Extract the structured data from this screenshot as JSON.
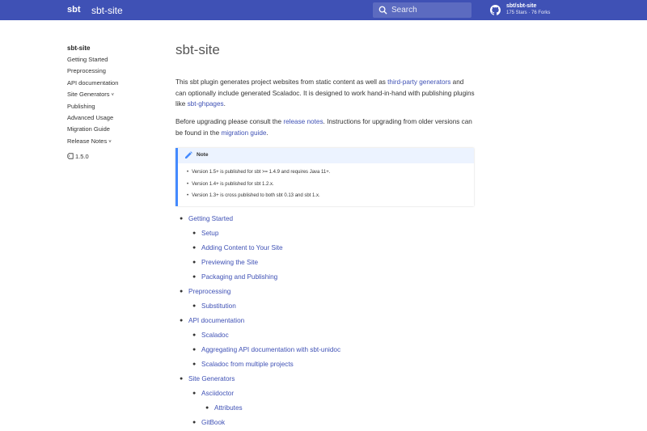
{
  "header": {
    "logo": "sbt",
    "title": "sbt-site",
    "search_placeholder": "Search",
    "repo_name": "sbt/sbt-site",
    "repo_stats": "175 Stars · 76 Forks"
  },
  "sidebar": {
    "title": "sbt-site",
    "items": [
      {
        "label": "Getting Started",
        "chevron": ""
      },
      {
        "label": "Preprocessing",
        "chevron": ""
      },
      {
        "label": "API documentation",
        "chevron": ""
      },
      {
        "label": "Site Generators",
        "chevron": "˅"
      },
      {
        "label": "Publishing",
        "chevron": ""
      },
      {
        "label": "Advanced Usage",
        "chevron": ""
      },
      {
        "label": "Migration Guide",
        "chevron": ""
      },
      {
        "label": "Release Notes",
        "chevron": "˅"
      }
    ],
    "version": "1.5.0"
  },
  "main": {
    "title": "sbt-site",
    "intro": {
      "t1": "This sbt plugin generates project websites from static content as well as ",
      "link1": "third-party generators",
      "t2": " and can optionally include generated Scaladoc. It is designed to work hand-in-hand with publishing plugins like ",
      "link2": "sbt-ghpages",
      "t3": "."
    },
    "upgrade": {
      "t1": "Before upgrading please consult the ",
      "link1": "release notes",
      "t2": ". Instructions for upgrading from older versions can be found in the ",
      "link2": "migration guide",
      "t3": "."
    },
    "note": {
      "title": "Note",
      "items": [
        "Version 1.5+ is published for sbt >= 1.4.9 and requires Java 11+.",
        "Version 1.4+ is published for sbt 1.2.x.",
        "Version 1.3+ is cross published to both sbt 0.13 and sbt 1.x."
      ]
    },
    "toc": [
      {
        "label": "Getting Started",
        "level": 1
      },
      {
        "label": "Setup",
        "level": 2
      },
      {
        "label": "Adding Content to Your Site",
        "level": 2
      },
      {
        "label": "Previewing the Site",
        "level": 2
      },
      {
        "label": "Packaging and Publishing",
        "level": 2
      },
      {
        "label": "Preprocessing",
        "level": 1
      },
      {
        "label": "Substitution",
        "level": 2
      },
      {
        "label": "API documentation",
        "level": 1
      },
      {
        "label": "Scaladoc",
        "level": 2
      },
      {
        "label": "Aggregating API documentation with sbt-unidoc",
        "level": 2
      },
      {
        "label": "Scaladoc from multiple projects",
        "level": 2
      },
      {
        "label": "Site Generators",
        "level": 1
      },
      {
        "label": "Asciidoctor",
        "level": 2
      },
      {
        "label": "Attributes",
        "level": 3
      },
      {
        "label": "GitBook",
        "level": 2
      }
    ]
  },
  "colors": {
    "header_bg": "#3f51b5",
    "link": "#3f51b5",
    "note_accent": "#448aff"
  }
}
